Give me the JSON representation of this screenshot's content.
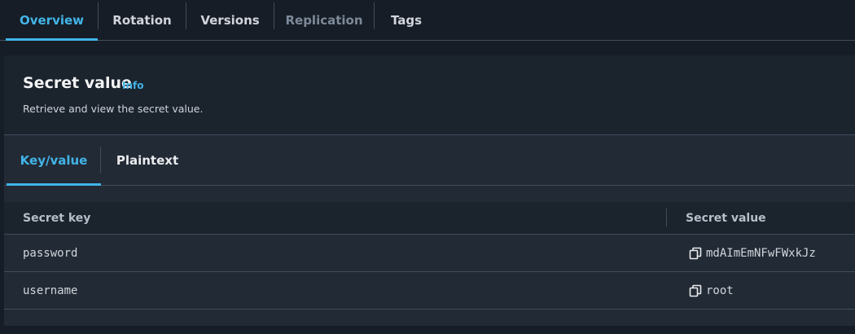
{
  "top_tabs": [
    {
      "label": "Overview",
      "state": "active"
    },
    {
      "label": "Rotation",
      "state": "normal"
    },
    {
      "label": "Versions",
      "state": "normal"
    },
    {
      "label": "Replication",
      "state": "disabled"
    },
    {
      "label": "Tags",
      "state": "normal"
    }
  ],
  "secret_section": {
    "title": "Secret value",
    "info_link": "Info",
    "description": "Retrieve and view the secret value."
  },
  "value_tabs": [
    {
      "label": "Key/value",
      "state": "active"
    },
    {
      "label": "Plaintext",
      "state": "normal"
    }
  ],
  "table": {
    "columns": [
      "Secret key",
      "Secret value"
    ],
    "rows": [
      {
        "key": "password",
        "value": "mdAImEmNFwFWxkJz",
        "icon": "copy-icon"
      },
      {
        "key": "username",
        "value": "root",
        "icon": "copy-icon"
      }
    ]
  },
  "colors": {
    "accent": "#42b4e8",
    "background": "#161d26",
    "panel": "#222a35",
    "border": "#414d5c"
  }
}
